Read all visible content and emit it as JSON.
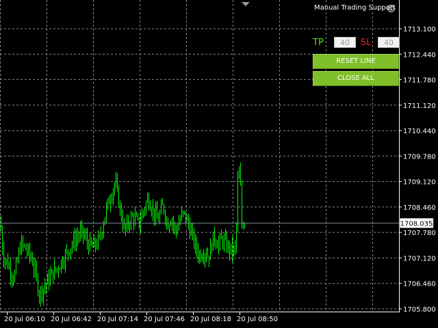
{
  "panel": {
    "title": "Manual Trading Support",
    "icon": "smiley-icon",
    "tp_label": "TP",
    "tp_value": "40",
    "sl_label": "SL",
    "sl_value": "40",
    "reset_label": "RESET LINE",
    "close_label": "CLOSE ALL"
  },
  "colors": {
    "background": "#000000",
    "grid": "#8a8a8a",
    "candles": "#00ff00",
    "price_line": "#778899",
    "axis_text": "#ffffff",
    "tp_color": "#5fdc1f",
    "sl_color": "#ff2020",
    "button": "#7fbf2a"
  },
  "chart_data": {
    "type": "bar",
    "y_ticks": [
      "1713.100",
      "1712.440",
      "1711.780",
      "1711.120",
      "1710.440",
      "1709.780",
      "1709.120",
      "1708.460",
      "1707.780",
      "1707.120",
      "1706.460",
      "1705.800"
    ],
    "x_ticks": [
      "20 Jul 06:10",
      "20 Jul 06:42",
      "20 Jul 07:14",
      "20 Jul 07:46",
      "20 Jul 08:18",
      "20 Jul 08:50"
    ],
    "ylim": [
      1705.8,
      1713.1
    ],
    "current_price": "1708.035",
    "grid": true,
    "waypoints": [
      [
        0,
        1708.1
      ],
      [
        4,
        1707.2
      ],
      [
        10,
        1707.0
      ],
      [
        20,
        1706.6
      ],
      [
        30,
        1707.5
      ],
      [
        40,
        1707.3
      ],
      [
        48,
        1707.0
      ],
      [
        57,
        1706.2
      ],
      [
        65,
        1706.4
      ],
      [
        75,
        1706.7
      ],
      [
        85,
        1706.9
      ],
      [
        95,
        1707.2
      ],
      [
        105,
        1707.5
      ],
      [
        113,
        1707.7
      ],
      [
        120,
        1707.8
      ],
      [
        128,
        1707.5
      ],
      [
        135,
        1707.4
      ],
      [
        145,
        1707.6
      ],
      [
        155,
        1708.4
      ],
      [
        162,
        1708.8
      ],
      [
        168,
        1709.1
      ],
      [
        175,
        1708.4
      ],
      [
        182,
        1707.8
      ],
      [
        188,
        1708.1
      ],
      [
        195,
        1708.2
      ],
      [
        202,
        1708.0
      ],
      [
        210,
        1708.4
      ],
      [
        216,
        1708.7
      ],
      [
        222,
        1708.4
      ],
      [
        230,
        1708.1
      ],
      [
        238,
        1708.5
      ],
      [
        244,
        1708.0
      ],
      [
        250,
        1708.2
      ],
      [
        256,
        1707.8
      ],
      [
        262,
        1708.1
      ],
      [
        268,
        1708.3
      ],
      [
        275,
        1708.0
      ],
      [
        282,
        1707.6
      ],
      [
        290,
        1707.2
      ],
      [
        298,
        1707.3
      ],
      [
        305,
        1707.2
      ],
      [
        312,
        1707.7
      ],
      [
        318,
        1707.5
      ],
      [
        325,
        1707.6
      ],
      [
        333,
        1707.4
      ],
      [
        340,
        1707.3
      ],
      [
        344,
        1707.4
      ],
      [
        347,
        1709.1
      ],
      [
        350,
        1709.4
      ],
      [
        353,
        1708.0
      ],
      [
        357,
        1708.1
      ]
    ]
  }
}
